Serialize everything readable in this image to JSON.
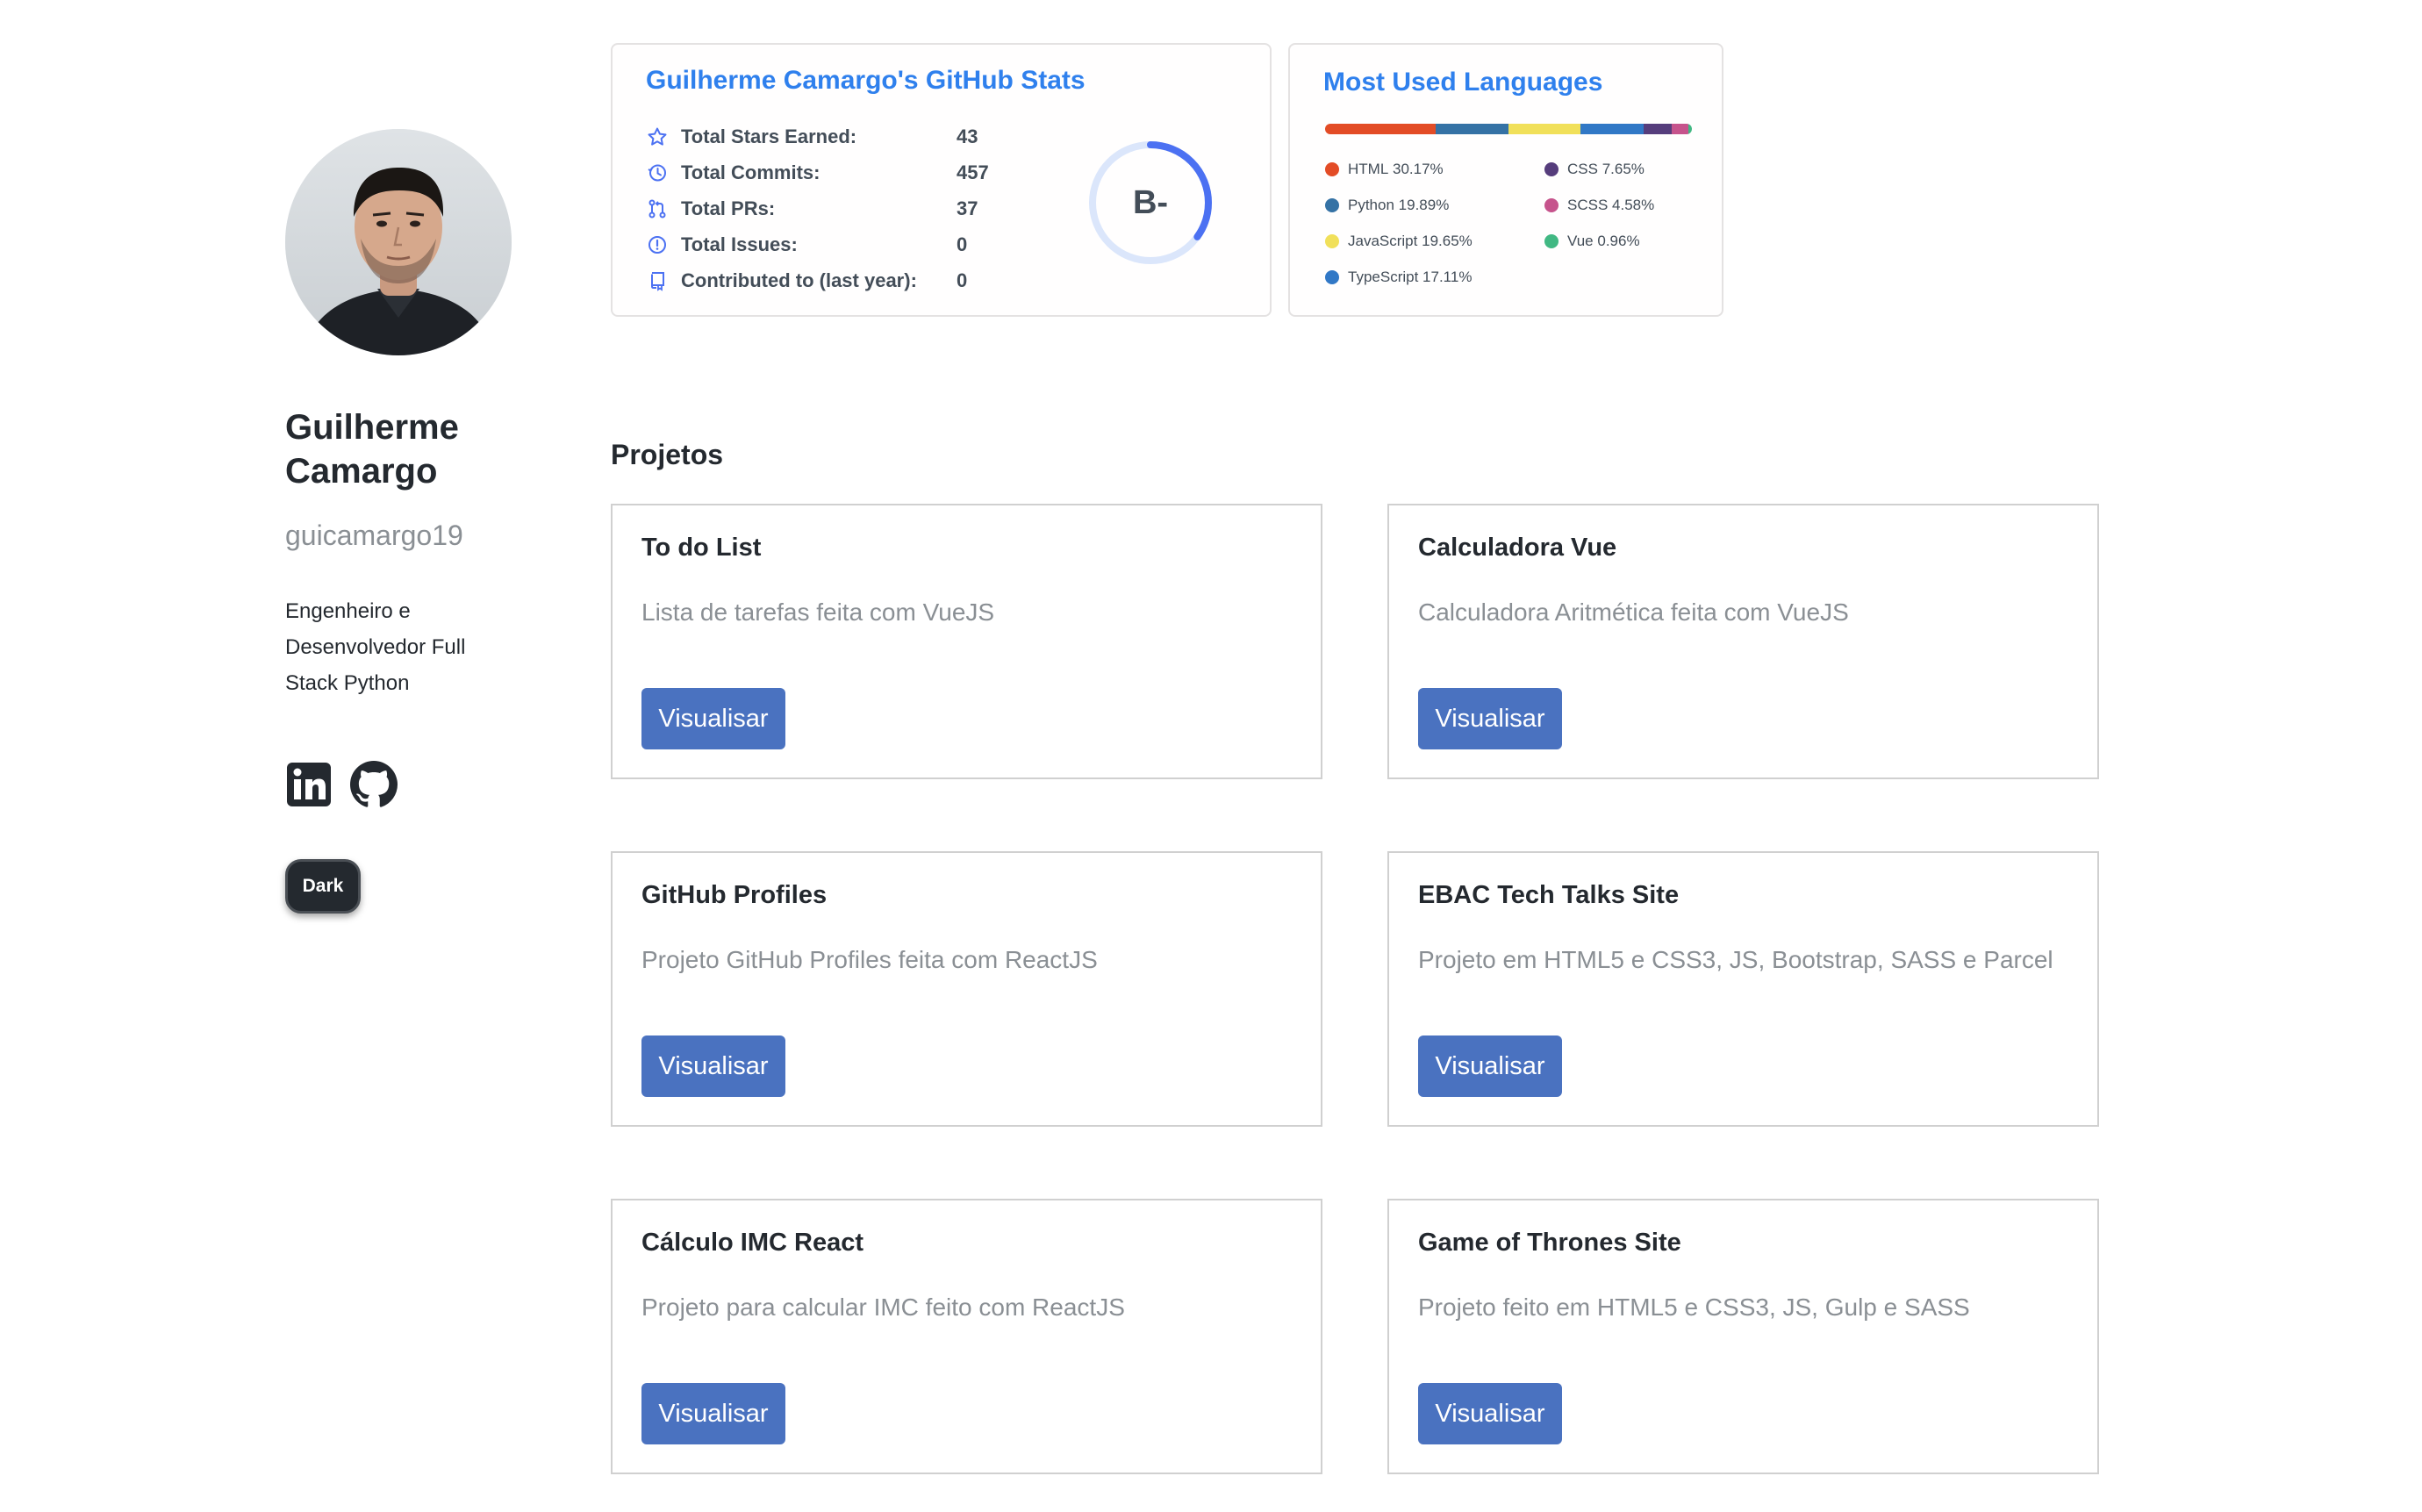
{
  "profile": {
    "name": "Guilherme Camargo",
    "username": "guicamargo19",
    "bio": "Engenheiro e Desenvolvedor Full Stack Python",
    "theme_button_label": "Dark"
  },
  "social": [
    {
      "icon": "linkedin-icon"
    },
    {
      "icon": "github-icon"
    }
  ],
  "stats": {
    "title": "Guilherme Camargo's GitHub Stats",
    "rows": [
      {
        "icon": "star-icon",
        "label": "Total Stars Earned:",
        "value": "43"
      },
      {
        "icon": "history-icon",
        "label": "Total Commits:",
        "value": "457"
      },
      {
        "icon": "pull-request-icon",
        "label": "Total PRs:",
        "value": "37"
      },
      {
        "icon": "issue-icon",
        "label": "Total Issues:",
        "value": "0"
      },
      {
        "icon": "repo-icon",
        "label": "Contributed to (last year):",
        "value": "0"
      }
    ],
    "grade": "B-",
    "grade_ring_fraction": 0.35,
    "accent_color": "#2f80ed"
  },
  "languages": {
    "title": "Most Used Languages",
    "items": [
      {
        "name": "HTML",
        "percent": "30.17%",
        "value": 30.17,
        "color": "#e34c26"
      },
      {
        "name": "Python",
        "percent": "19.89%",
        "value": 19.89,
        "color": "#3572A5"
      },
      {
        "name": "JavaScript",
        "percent": "19.65%",
        "value": 19.65,
        "color": "#f1e05a"
      },
      {
        "name": "TypeScript",
        "percent": "17.11%",
        "value": 17.11,
        "color": "#3178c6"
      },
      {
        "name": "CSS",
        "percent": "7.65%",
        "value": 7.65,
        "color": "#563d7c"
      },
      {
        "name": "SCSS",
        "percent": "4.58%",
        "value": 4.58,
        "color": "#c6538c"
      },
      {
        "name": "Vue",
        "percent": "0.96%",
        "value": 0.96,
        "color": "#41b883"
      }
    ]
  },
  "projects_heading": "Projetos",
  "projects": [
    {
      "title": "To do List",
      "description": "Lista de tarefas feita com VueJS",
      "button": "Visualisar"
    },
    {
      "title": "Calculadora Vue",
      "description": "Calculadora Aritmética feita com VueJS",
      "button": "Visualisar"
    },
    {
      "title": "GitHub Profiles",
      "description": "Projeto GitHub Profiles feita com ReactJS",
      "button": "Visualisar"
    },
    {
      "title": "EBAC Tech Talks Site",
      "description": "Projeto em HTML5 e CSS3, JS, Bootstrap, SASS e Parcel",
      "button": "Visualisar"
    },
    {
      "title": "Cálculo IMC React",
      "description": "Projeto para calcular IMC feito com ReactJS",
      "button": "Visualisar"
    },
    {
      "title": "Game of Thrones Site",
      "description": "Projeto feito em HTML5 e CSS3, JS, Gulp e SASS",
      "button": "Visualisar"
    }
  ],
  "colors": {
    "button_blue": "#4a72c0",
    "card_title_blue": "#2f80ed"
  }
}
